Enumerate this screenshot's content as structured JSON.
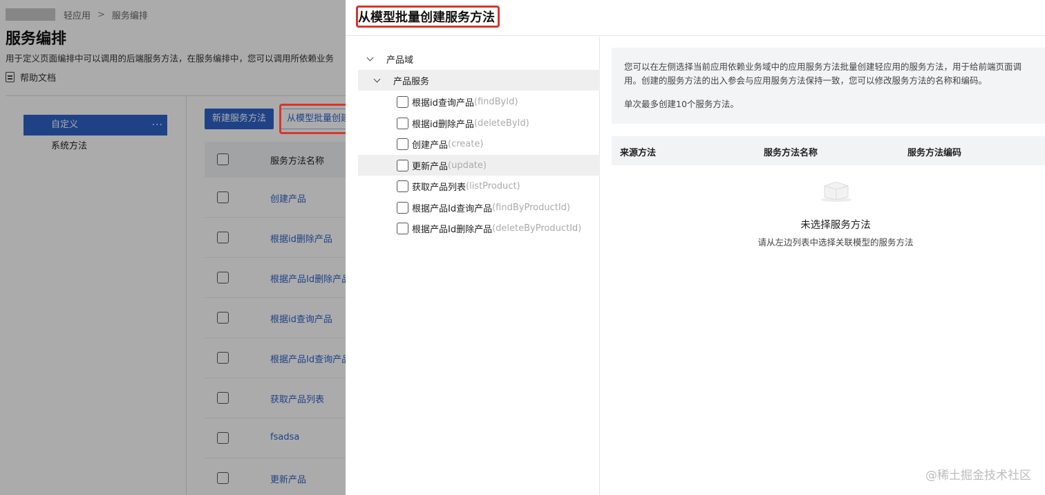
{
  "breadcrumb": {
    "items": [
      "轻应用",
      "服务编排"
    ],
    "separator": ">"
  },
  "page": {
    "title": "服务编排",
    "description": "用于定义页面编排中可以调用的后端服务方法，在服务编排中，您可以调用所依赖业务",
    "help_link": "帮助文档"
  },
  "sidebar": {
    "items": [
      {
        "label": "自定义",
        "active": true,
        "more": "···"
      },
      {
        "label": "系统方法",
        "active": false
      }
    ]
  },
  "toolbar": {
    "new_button": "新建服务方法",
    "batch_button": "从模型批量创建"
  },
  "table": {
    "header": "服务方法名称",
    "rows": [
      "创建产品",
      "根据id删除产品",
      "根据产品Id删除产品",
      "根据id查询产品",
      "根据产品Id查询产品",
      "获取产品列表",
      "fsadsa",
      "更新产品"
    ]
  },
  "drawer": {
    "title": "从模型批量创建服务方法",
    "tree": {
      "domain": "产品域",
      "service": "产品服务",
      "methods": [
        {
          "name": "根据id查询产品",
          "code": "(findById)"
        },
        {
          "name": "根据id删除产品",
          "code": "(deleteById)"
        },
        {
          "name": "创建产品",
          "code": "(create)"
        },
        {
          "name": "更新产品",
          "code": "(update)"
        },
        {
          "name": "获取产品列表",
          "code": "(listProduct)"
        },
        {
          "name": "根据产品Id查询产品",
          "code": "(findByProductId)"
        },
        {
          "name": "根据产品Id删除产品",
          "code": "(deleteByProductId)"
        }
      ]
    },
    "info": {
      "line1": "您可以在左侧选择当前应用依赖业务域中的应用服务方法批量创建轻应用的服务方法，用于给前端页面调",
      "line2": "用。创建的服务方法的出入参会与应用服务方法保持一致，您可以修改服务方法的名称和编码。",
      "line3": "单次最多创建10个服务方法。"
    },
    "columns": [
      "来源方法",
      "服务方法名称",
      "服务方法编码"
    ],
    "empty": {
      "title": "未选择服务方法",
      "subtitle": "请从左边列表中选择关联模型的服务方法"
    }
  },
  "watermark": "@稀土掘金技术社区",
  "colors": {
    "primary": "#2f63c9",
    "highlight": "#d9342b"
  }
}
